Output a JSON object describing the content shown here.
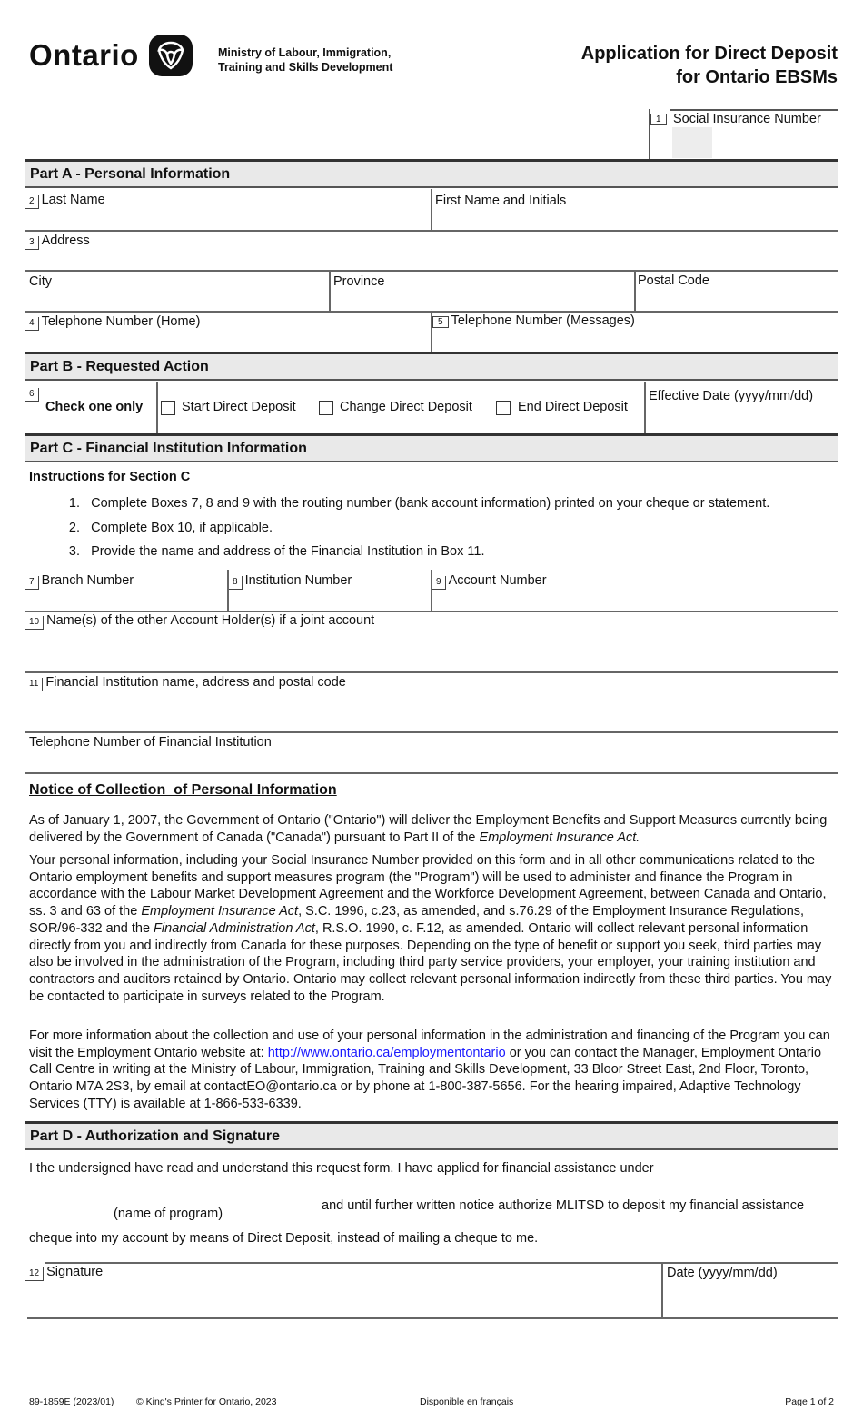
{
  "header": {
    "logo_word": "Ontario",
    "ministry_line1": "Ministry of Labour, Immigration,",
    "ministry_line2": "Training and Skills Development",
    "title_line1": "Application for Direct Deposit",
    "title_line2": "for Ontario EBSMs"
  },
  "sin": {
    "number": "1",
    "label": "Social Insurance Number",
    "value": ""
  },
  "part_a": {
    "title": "Part A - Personal Information",
    "last_name": {
      "number": "2",
      "label": "Last Name",
      "value": ""
    },
    "first_name": {
      "label": "First Name and Initials",
      "value": ""
    },
    "address": {
      "number": "3",
      "label": "Address",
      "value": ""
    },
    "city": {
      "label": "City",
      "value": ""
    },
    "province": {
      "label": "Province",
      "value": ""
    },
    "postal_code": {
      "label": "Postal Code",
      "value": ""
    },
    "phone_home": {
      "number": "4",
      "label": "Telephone Number (Home)",
      "value": ""
    },
    "phone_messages": {
      "number": "5",
      "label": "Telephone Number (Messages)",
      "value": ""
    }
  },
  "part_b": {
    "title": "Part B - Requested Action",
    "number": "6",
    "check_label": "Check one only",
    "options": [
      {
        "label": "Start Direct Deposit",
        "checked": false
      },
      {
        "label": "Change Direct Deposit",
        "checked": false
      },
      {
        "label": "End Direct Deposit",
        "checked": false
      }
    ],
    "effective_date": {
      "label": "Effective Date (yyyy/mm/dd)",
      "value": ""
    }
  },
  "part_c": {
    "title": "Part C - Financial Institution Information",
    "instructions_title": "Instructions for Section C",
    "instructions": [
      {
        "num": "1.",
        "text": "Complete Boxes 7, 8 and 9 with the routing number (bank account information) printed on your cheque or statement."
      },
      {
        "num": "2.",
        "text": "Complete Box 10, if applicable."
      },
      {
        "num": "3.",
        "text": "Provide the name and address of the Financial Institution in Box 11."
      }
    ],
    "branch": {
      "number": "7",
      "label": "Branch Number",
      "value": ""
    },
    "institution": {
      "number": "8",
      "label": "Institution Number",
      "value": ""
    },
    "account": {
      "number": "9",
      "label": "Account Number",
      "value": ""
    },
    "joint_holders": {
      "number": "10",
      "label": "Name(s) of the other Account Holder(s) if a joint account",
      "value": ""
    },
    "fi_name_address": {
      "number": "11",
      "label": "Financial Institution name, address and postal code",
      "value": ""
    },
    "fi_phone": {
      "label": "Telephone Number of Financial Institution",
      "value": ""
    }
  },
  "notice": {
    "title": "Notice of Collection  of Personal Information",
    "p1_a": "As of January 1, 2007, the Government of Ontario (\"Ontario\") will deliver the Employment Benefits and Support Measures currently being delivered by the Government of Canada (\"Canada\") pursuant to Part II of the ",
    "p1_italic": "Employment Insurance Act.",
    "p2_a": "Your personal information, including your Social Insurance Number provided on this form and in all other communications related to the Ontario employment benefits and support measures program (the \"Program\") will be used to administer and finance the Program in accordance with the Labour Market Development Agreement and the Workforce Development Agreement, between Canada and Ontario, ss. 3 and 63 of the ",
    "p2_i1": "Employment Insurance Act",
    "p2_b": ", S.C. 1996, c.23, as amended, and s.76.29 of the Employment Insurance Regulations, SOR/96-332 and the ",
    "p2_i2": "Financial Administration Act",
    "p2_c": ", R.S.O. 1990, c. F.12, as amended. Ontario will collect relevant personal information directly from you and indirectly from Canada for these purposes. Depending on the type of benefit or support you seek, third parties may also be involved in the administration of the Program, including third party service providers, your employer, your training institution and contractors and auditors retained by Ontario. Ontario may collect relevant personal information indirectly from these third parties. You may be contacted to participate in surveys related to the Program.",
    "p3_a": "For more information about the collection and use of your personal information in the administration and financing of the Program you can visit the Employment Ontario website at: ",
    "p3_link": "http://www.ontario.ca/employmentontario",
    "p3_b": " or you can contact the Manager, Employment Ontario Call Centre in writing at the Ministry of Labour, Immigration, Training and Skills Development, 33 Bloor Street East, 2nd Floor, Toronto, Ontario  M7A 2S3, by email at contactEO@ontario.ca or by phone at 1-800-387-5656. For the hearing impaired, Adaptive Technology Services (TTY) is available at 1-866-533-6339."
  },
  "part_d": {
    "title": "Part D - Authorization and Signature",
    "line1": "I the undersigned have read and understand this request form. I have applied for financial assistance under",
    "program_caption": "(name of program)",
    "program_value": "",
    "line2": "and until further written notice authorize MLITSD to deposit my financial assistance",
    "line3": "cheque into my account by means of Direct Deposit, instead of mailing a cheque to me.",
    "signature": {
      "number": "12",
      "label": "Signature"
    },
    "date": {
      "label": "Date (yyyy/mm/dd)",
      "value": ""
    }
  },
  "footer": {
    "form_number": "89-1859E (2023/01)",
    "copyright": "© King's Printer for Ontario, 2023",
    "french": "Disponible en français",
    "page": "Page 1 of 2"
  }
}
